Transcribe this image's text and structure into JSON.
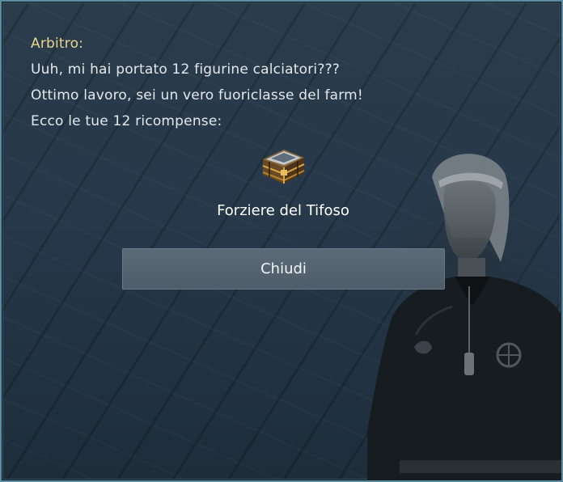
{
  "dialog": {
    "speaker": "Arbitro:",
    "lines": [
      "Uuh, mi hai portato 12 figurine calciatori???",
      "Ottimo lavoro, sei un vero fuoriclasse del farm!",
      "Ecco le tue 12 ricompense:"
    ]
  },
  "reward": {
    "icon": "treasure-chest-icon",
    "name": "Forziere del Tifoso"
  },
  "close_button": {
    "label": "Chiudi"
  },
  "colors": {
    "border": "#5b8ea3",
    "speaker": "#e9d58f",
    "text": "#e4e8ea",
    "button": "#55646f"
  }
}
